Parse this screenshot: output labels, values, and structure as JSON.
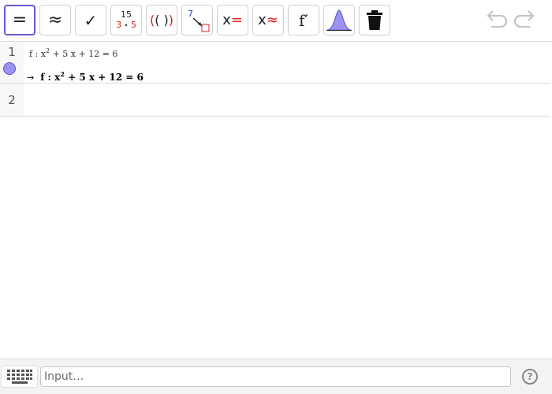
{
  "toolbar": {
    "tools": [
      {
        "name": "evaluate-tool",
        "glyph": "="
      },
      {
        "name": "numeric-tool",
        "glyph": "≈"
      },
      {
        "name": "keep-input-tool",
        "glyph": "✓"
      },
      {
        "name": "factor-tool",
        "top": "15",
        "bottom_left": "3",
        "bottom_dot": "•",
        "bottom_right": "5"
      },
      {
        "name": "expand-tool",
        "outer_open": "(",
        "inner": "( )",
        "outer_close": ")"
      },
      {
        "name": "substitute-tool",
        "digit": "7"
      },
      {
        "name": "solve-tool",
        "var": "x",
        "sym": "="
      },
      {
        "name": "solve-numerically-tool",
        "var": "x",
        "sym": "≈"
      },
      {
        "name": "derivative-tool",
        "glyph": "f′"
      },
      {
        "name": "probability-calculator-tool"
      },
      {
        "name": "delete-tool"
      }
    ],
    "colors": {
      "accent": "#6557d2",
      "red": "#e02020",
      "blue": "#3344cc",
      "curve_fill": "#9a94f0"
    }
  },
  "algebra": {
    "rows": [
      {
        "number": "1",
        "input": {
          "prefix": "f : x",
          "exp": "2",
          "rest": " + 5 x + 12 = 6"
        },
        "output": {
          "arrow": "→",
          "prefix": "f :  x",
          "exp": "2",
          "rest": " + 5 x + 12 = 6"
        },
        "dot_color": "#9a94f0"
      },
      {
        "number": "2"
      }
    ]
  },
  "inputbar": {
    "placeholder": "Input…",
    "help_glyph": "?"
  }
}
